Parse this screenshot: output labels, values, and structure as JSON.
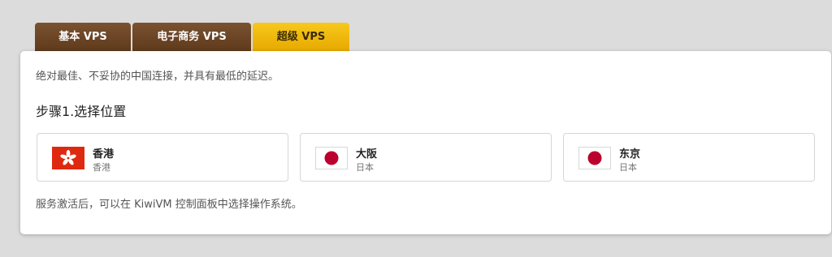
{
  "tabs": [
    {
      "label": "基本 VPS",
      "active": false
    },
    {
      "label": "电子商务 VPS",
      "active": false
    },
    {
      "label": "超级 VPS",
      "active": true
    }
  ],
  "panel": {
    "description": "绝对最佳、不妥协的中国连接，并具有最低的延迟。",
    "step_title": "步骤1.选择位置",
    "locations": [
      {
        "name": "香港",
        "country": "香港",
        "flag": "hong-kong-flag-icon"
      },
      {
        "name": "大阪",
        "country": "日本",
        "flag": "japan-flag-icon"
      },
      {
        "name": "东京",
        "country": "日本",
        "flag": "japan-flag-icon"
      }
    ],
    "note": "服务激活后，可以在 KiwiVM 控制面板中选择操作系统。"
  },
  "colors": {
    "tab_brown": "#6b4423",
    "tab_active_gold": "#f2bb0f",
    "hk_red": "#de2910",
    "japan_red": "#bc002d"
  }
}
